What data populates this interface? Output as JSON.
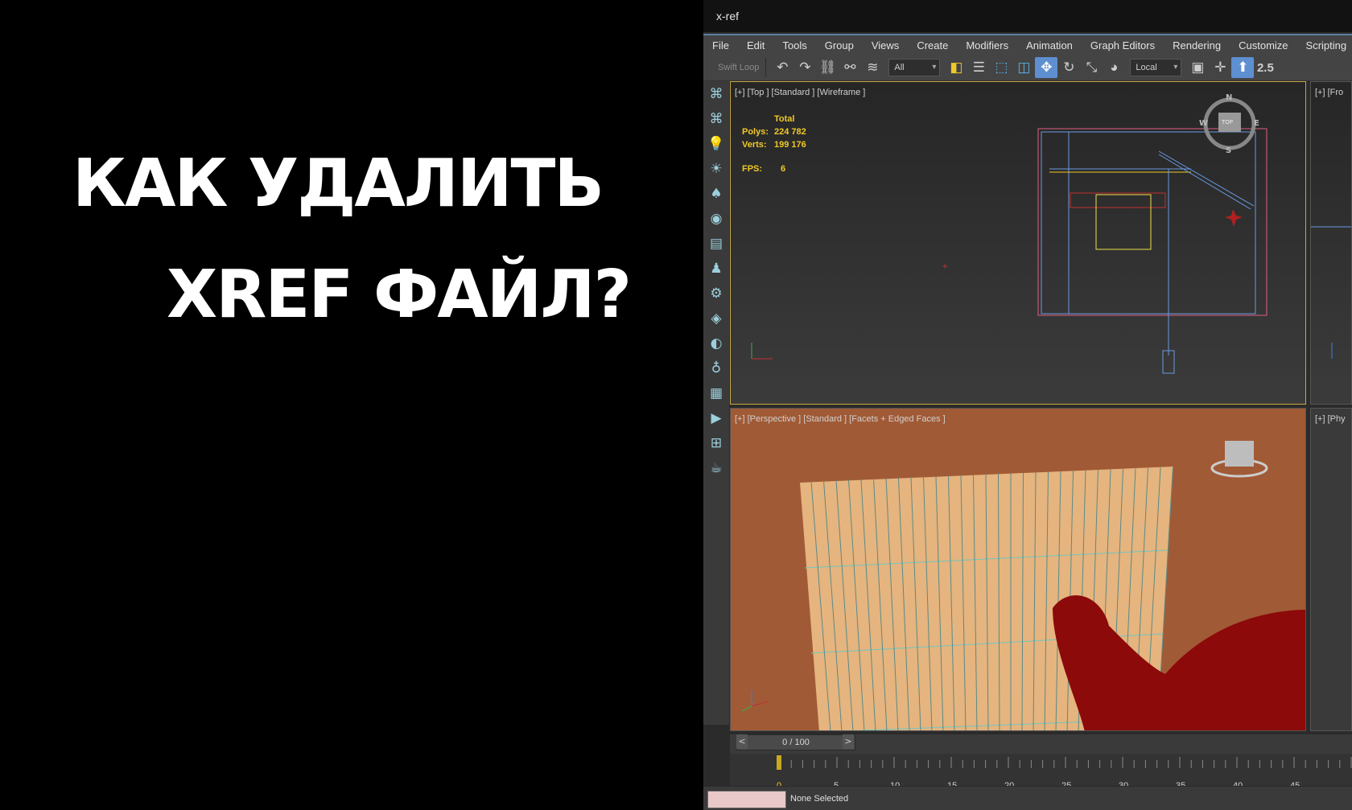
{
  "headline": {
    "line1": "КАК УДАЛИТЬ",
    "line2": "XREF ФАЙЛ?"
  },
  "window": {
    "title": "x-ref"
  },
  "menu": [
    "File",
    "Edit",
    "Tools",
    "Group",
    "Views",
    "Create",
    "Modifiers",
    "Animation",
    "Graph Editors",
    "Rendering",
    "Customize",
    "Scripting"
  ],
  "toolbar": {
    "label": "Swift Loop",
    "filter_value": "All",
    "coord_value": "Local",
    "snap_label": "2.5"
  },
  "viewport_top": {
    "label": "[+] [Top ] [Standard ] [Wireframe ]",
    "stats_header": "Total",
    "polys_label": "Polys:",
    "polys_value": "224 782",
    "verts_label": "Verts:",
    "verts_value": "199 176",
    "fps_label": "FPS:",
    "fps_value": "6",
    "compass": {
      "n": "N",
      "s": "S",
      "e": "E",
      "w": "W",
      "cube": "TOP"
    }
  },
  "viewport_persp": {
    "label": "[+] [Perspective ] [Standard ] [Facets + Edged Faces ]"
  },
  "viewport_right1": {
    "label": "[+] [Fro"
  },
  "viewport_right2": {
    "label": "[+] [Phy"
  },
  "timeline": {
    "frame_display": "0 / 100",
    "prev": "<",
    "next": ">",
    "ticks": [
      "0",
      "5",
      "10",
      "15",
      "20",
      "25",
      "30",
      "35",
      "40",
      "45"
    ]
  },
  "status": {
    "selection": "None Selected"
  }
}
